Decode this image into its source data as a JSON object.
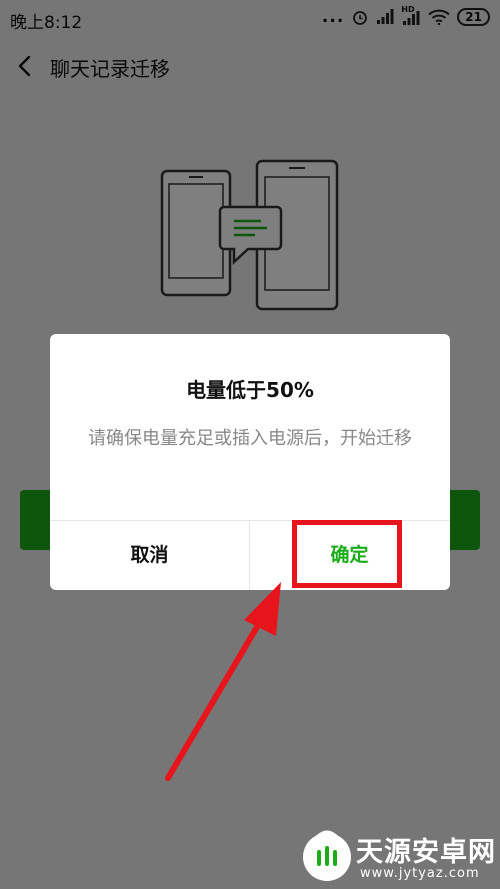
{
  "status_bar": {
    "time": "晚上8:12",
    "dots": "...",
    "hd_label": "HD",
    "battery": "21"
  },
  "nav": {
    "title": "聊天记录迁移"
  },
  "dialog": {
    "title": "电量低于50%",
    "message": "请确保电量充足或插入电源后，开始迁移",
    "cancel_label": "取消",
    "confirm_label": "确定"
  },
  "watermark": {
    "name": "天源安卓网",
    "url": "www.jytyaz.com"
  },
  "colors": {
    "accent_green": "#1aad19",
    "highlight_red": "#e8141b",
    "overlay": "rgba(0,0,0,0.5)"
  }
}
